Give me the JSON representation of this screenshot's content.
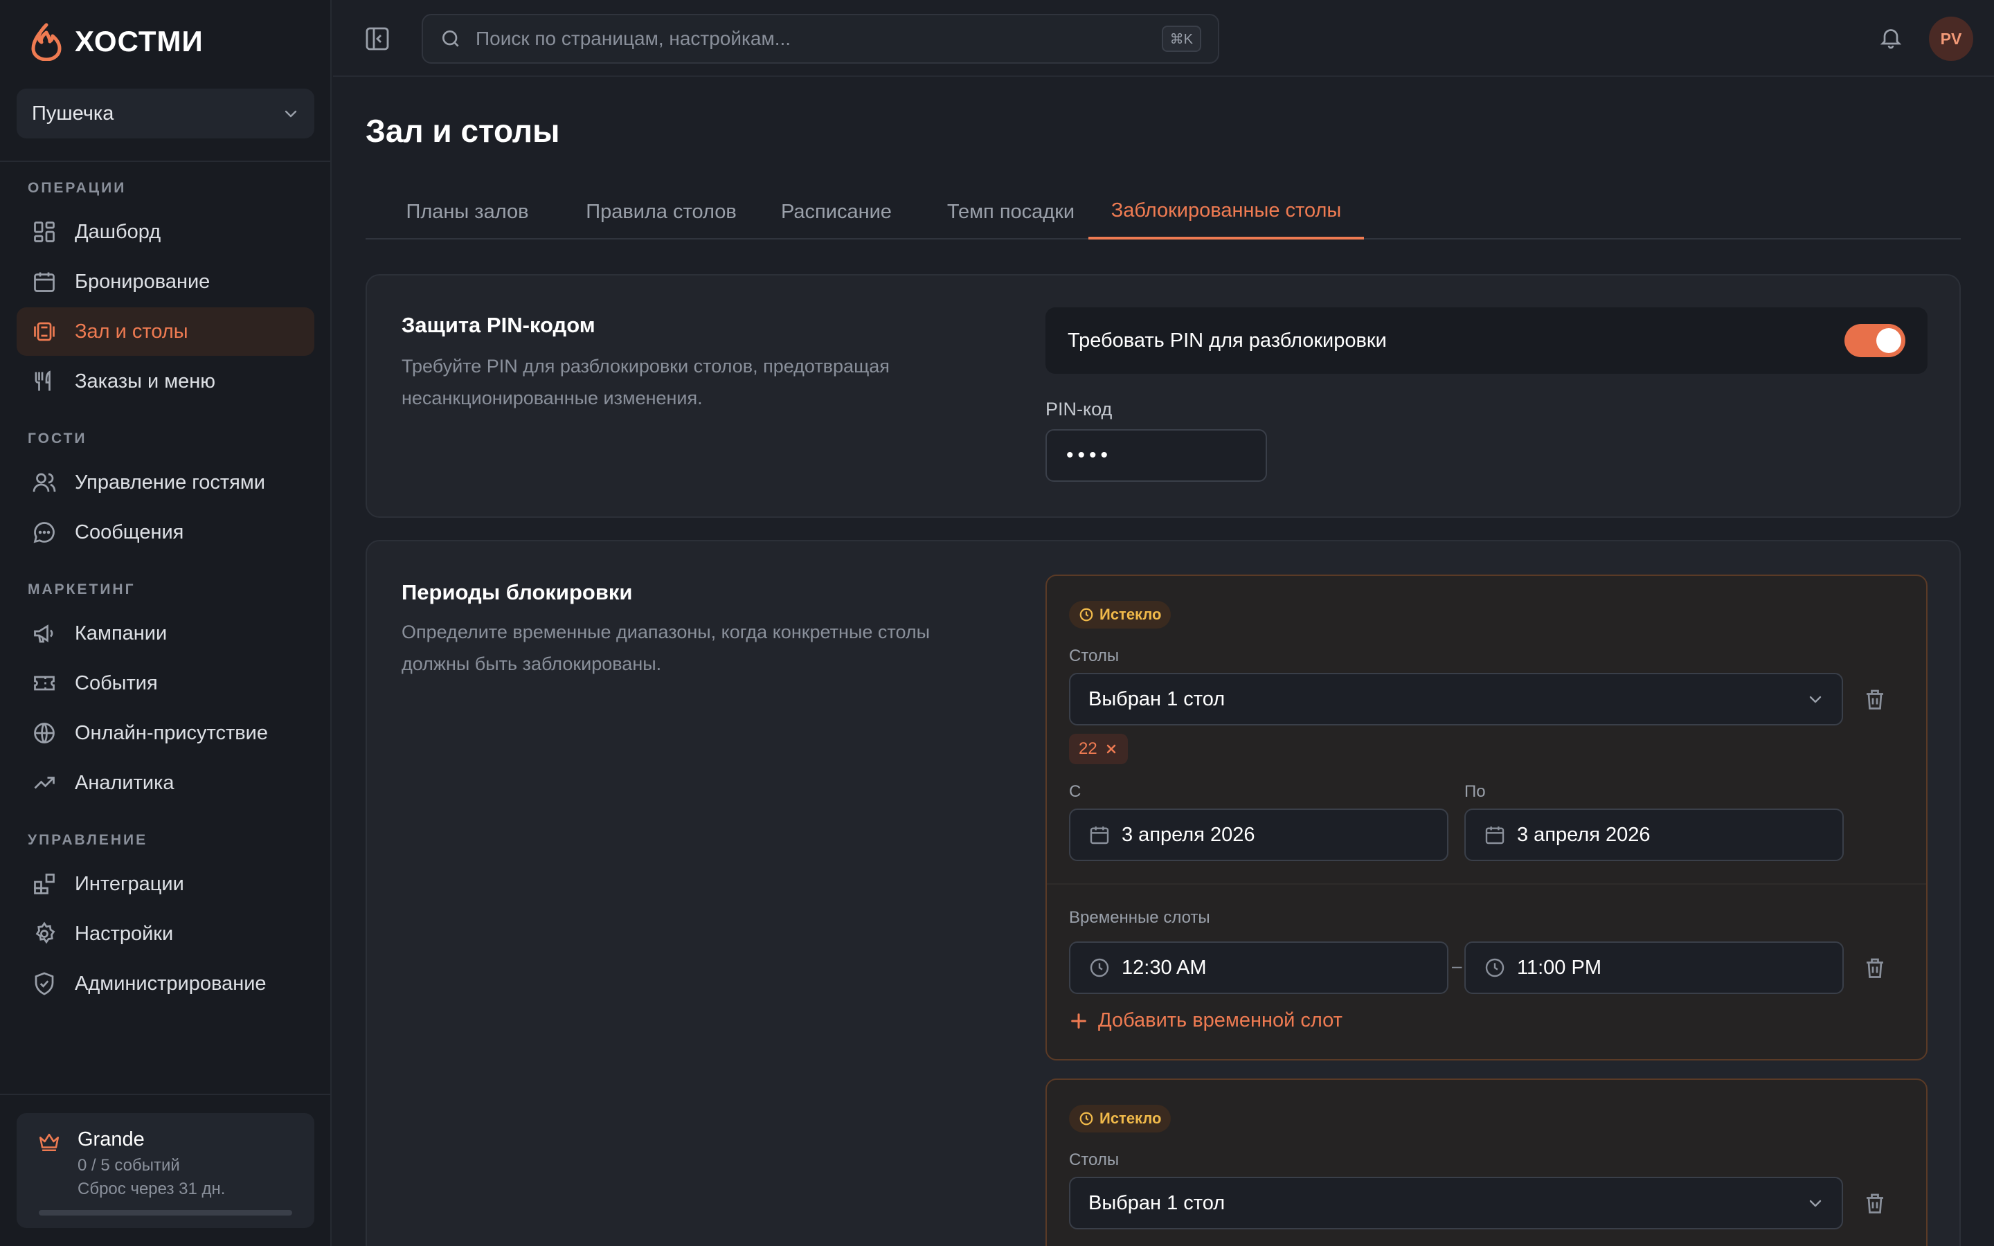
{
  "app": {
    "name": "ХОСТМИ",
    "accent": "#ef7b52"
  },
  "venue": {
    "name": "Пушечка"
  },
  "sidebar": {
    "sections": {
      "operations": "ОПЕРАЦИИ",
      "guests": "ГОСТИ",
      "marketing": "МАРКЕТИНГ",
      "management": "УПРАВЛЕНИЕ"
    },
    "items": [
      {
        "label": "Дашборд",
        "icon": "dashboard-icon"
      },
      {
        "label": "Бронирование",
        "icon": "calendar-icon"
      },
      {
        "label": "Зал и столы",
        "icon": "tables-icon",
        "active": true
      },
      {
        "label": "Заказы и меню",
        "icon": "utensils-icon"
      },
      {
        "label": "Управление гостями",
        "icon": "users-icon"
      },
      {
        "label": "Сообщения",
        "icon": "message-icon"
      },
      {
        "label": "Кампании",
        "icon": "megaphone-icon"
      },
      {
        "label": "События",
        "icon": "ticket-icon"
      },
      {
        "label": "Онлайн-присутствие",
        "icon": "globe-icon"
      },
      {
        "label": "Аналитика",
        "icon": "trend-icon"
      },
      {
        "label": "Интеграции",
        "icon": "puzzle-icon"
      },
      {
        "label": "Настройки",
        "icon": "gear-icon"
      },
      {
        "label": "Администрирование",
        "icon": "shield-icon"
      }
    ],
    "plan": {
      "name": "Grande",
      "events": "0 / 5 событий",
      "reset": "Сброс через 31 дн.",
      "usage_fraction": 0
    }
  },
  "topbar": {
    "search_placeholder": "Поиск по страницам, настройкам...",
    "shortcut": "⌘K",
    "avatar_initials": "PV"
  },
  "page": {
    "title": "Зал и столы",
    "tabs": [
      {
        "label": "Планы залов"
      },
      {
        "label": "Правила столов"
      },
      {
        "label": "Расписание"
      },
      {
        "label": "Темп посадки"
      },
      {
        "label": "Заблокированные столы",
        "active": true
      }
    ]
  },
  "pin_card": {
    "title": "Защита PIN-кодом",
    "description": "Требуйте PIN для разблокировки столов, предотвращая несанкционированные изменения.",
    "toggle_label": "Требовать PIN для разблокировки",
    "toggle_on": true,
    "pin_label": "PIN-код",
    "pin_value": "••••"
  },
  "periods_card": {
    "title": "Периоды блокировки",
    "description": "Определите временные диапазоны, когда конкретные столы должны быть заблокированы.",
    "periods": [
      {
        "status": "Истекло",
        "tables_label": "Столы",
        "tables_value": "Выбран 1 стол",
        "chip": "22",
        "from_label": "С",
        "from_value": "3 апреля 2026",
        "to_label": "По",
        "to_value": "3 апреля 2026",
        "slots_label": "Временные слоты",
        "slot_start": "12:30 AM",
        "slot_end": "11:00 PM",
        "slot_separator": "–",
        "add_slot": "Добавить временной слот"
      },
      {
        "status": "Истекло",
        "tables_label": "Столы",
        "tables_value": "Выбран 1 стол"
      }
    ]
  }
}
